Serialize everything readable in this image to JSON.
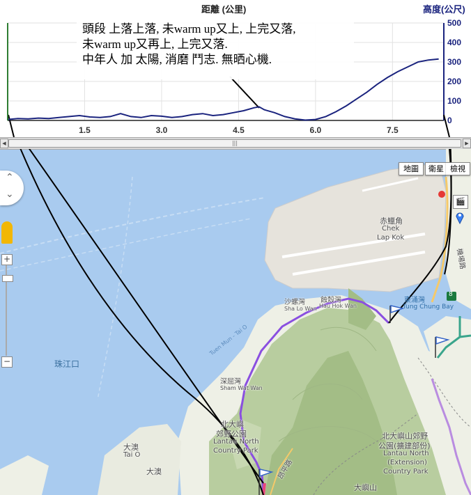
{
  "chart": {
    "title": "距離 (公里)",
    "y_title": "高度(公尺)",
    "note_lines": [
      "頭段 上落上落, 未warm up又上, 上完又落,",
      "未warm up又再上, 上完又落.",
      "中年人 加 太陽, 消磨 鬥志. 無晒心機."
    ],
    "colors": {
      "line": "#1a237e",
      "marker": "#2e7d32",
      "annotation": "#000000"
    }
  },
  "chart_data": {
    "type": "line",
    "title": "距離 (公里)",
    "xlabel": "距離 (公里)",
    "ylabel": "高度(公尺)",
    "xlim": [
      0,
      8.5
    ],
    "ylim": [
      0,
      500
    ],
    "x_ticks": [
      "1.5",
      "3.0",
      "4.5",
      "6.0",
      "7.5"
    ],
    "y_ticks": [
      "500",
      "400",
      "300",
      "200",
      "100",
      "0"
    ],
    "series": [
      {
        "x": [
          0,
          0.2,
          0.4,
          0.6,
          0.8,
          1.0,
          1.2,
          1.4,
          1.6,
          1.8,
          2.0,
          2.2,
          2.4,
          2.6,
          2.8,
          3.0,
          3.2,
          3.4,
          3.6,
          3.8,
          4.0,
          4.2,
          4.4,
          4.6,
          4.8,
          4.9,
          5.0,
          5.2,
          5.4,
          5.6,
          5.8,
          6.0,
          6.2,
          6.4,
          6.6,
          6.8,
          7.0,
          7.2,
          7.4,
          7.6,
          7.8,
          8.0,
          8.2,
          8.4
        ],
        "values": [
          5,
          10,
          8,
          12,
          10,
          15,
          20,
          25,
          18,
          15,
          20,
          35,
          20,
          15,
          25,
          22,
          15,
          20,
          30,
          35,
          25,
          30,
          40,
          50,
          65,
          70,
          55,
          40,
          20,
          8,
          2,
          5,
          20,
          45,
          75,
          110,
          145,
          185,
          220,
          250,
          275,
          300,
          310,
          315
        ]
      }
    ],
    "grid": true
  },
  "map": {
    "map_type_buttons": [
      "地圖",
      "衛星",
      "檢視"
    ],
    "labels": [
      {
        "text": "赤鱲角",
        "key": "a"
      },
      {
        "text": "Chek",
        "key": "b"
      },
      {
        "text": "Lap Kok",
        "key": "c"
      },
      {
        "text": "沙螺灣",
        "key": "d"
      },
      {
        "text": "Sha Lo Wan",
        "key": "e"
      },
      {
        "text": "蝕殼灣",
        "key": "f"
      },
      {
        "text": "Hau Hok Wan",
        "key": "g"
      },
      {
        "text": "東涌灣",
        "key": "h"
      },
      {
        "text": "Tung Chung Bay",
        "key": "i"
      },
      {
        "text": "深屈灣",
        "key": "j"
      },
      {
        "text": "Sham Wat Wan",
        "key": "k"
      },
      {
        "text": "北大嶼",
        "key": "l"
      },
      {
        "text": "郊野公園",
        "key": "m"
      },
      {
        "text": "Lantau North",
        "key": "n"
      },
      {
        "text": "Country Park",
        "key": "o"
      },
      {
        "text": "北大嶼山郊野",
        "key": "p"
      },
      {
        "text": "公園(擴建部份)",
        "key": "q"
      },
      {
        "text": "Lantau North",
        "key": "r"
      },
      {
        "text": "(Extension)",
        "key": "s"
      },
      {
        "text": "Country Park",
        "key": "t"
      },
      {
        "text": "大澳",
        "key": "u"
      },
      {
        "text": "Tai O",
        "key": "v"
      },
      {
        "text": "大澳",
        "key": "w"
      },
      {
        "text": "珠江口",
        "key": "x"
      },
      {
        "text": "Tuen Mun - Tai O",
        "key": "y"
      },
      {
        "text": "機場路",
        "key": "z"
      },
      {
        "text": "昂平路",
        "key": "aa"
      },
      {
        "text": "大嶼山",
        "key": "ab"
      },
      {
        "text": "8",
        "key": "ac"
      }
    ],
    "colors": {
      "sea": "#a9cbef",
      "land": "#eef0e6",
      "hill": "#b8cd9f",
      "route_purple": "#8a4fe0",
      "route_pink": "#e8467c",
      "route_teal": "#3aa58c"
    }
  }
}
